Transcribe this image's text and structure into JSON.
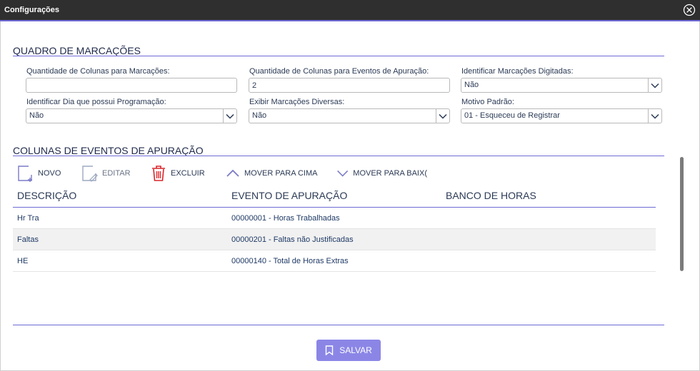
{
  "window": {
    "title": "Configurações"
  },
  "colors": {
    "accent": "#6e6ad6",
    "titlebar": "#2f2f2f",
    "button": "#8b86e6",
    "delete": "#d9262c"
  },
  "section_marcacoes": {
    "title": "QUADRO DE MARCAÇÕES",
    "fields": {
      "qtd_colunas_marcacoes": {
        "label": "Quantidade de Colunas para Marcações:",
        "value": ""
      },
      "qtd_colunas_eventos": {
        "label": "Quantidade de Colunas para Eventos de Apuração:",
        "value": "2"
      },
      "identificar_digitadas": {
        "label": "Identificar Marcações Digitadas:",
        "value": "Não"
      },
      "identificar_dia_programacao": {
        "label": "Identificar Dia que possui Programação:",
        "value": "Não"
      },
      "exibir_diversas": {
        "label": "Exibir Marcações Diversas:",
        "value": "Não"
      },
      "motivo_padrao": {
        "label": "Motivo Padrão:",
        "value": "01 - Esqueceu de Registrar"
      }
    }
  },
  "section_eventos": {
    "title": "COLUNAS DE EVENTOS DE APURAÇÃO",
    "toolbar": {
      "novo": "NOVO",
      "editar": "EDITAR",
      "excluir": "EXCLUIR",
      "mover_cima": "MOVER PARA CIMA",
      "mover_baixo": "MOVER PARA BAIX("
    },
    "columns": [
      "DESCRIÇÃO",
      "EVENTO DE APURAÇÃO",
      "BANCO DE HORAS"
    ],
    "rows": [
      {
        "descricao": "Hr Tra",
        "evento": "00000001 - Horas Trabalhadas",
        "banco": ""
      },
      {
        "descricao": "Faltas",
        "evento": "00000201 - Faltas não Justificadas",
        "banco": ""
      },
      {
        "descricao": "HE",
        "evento": "00000140 - Total de Horas Extras",
        "banco": ""
      }
    ]
  },
  "footer": {
    "save_label": "SALVAR"
  }
}
